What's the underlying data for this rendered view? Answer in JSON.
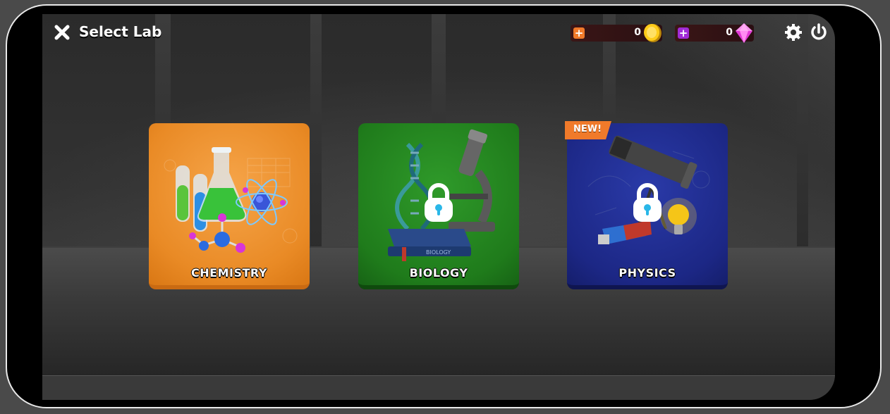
{
  "header": {
    "title": "Select Lab"
  },
  "currencies": {
    "coins": {
      "value": "0",
      "plus_color": "#f07a2a",
      "icon": "coin-icon"
    },
    "gems": {
      "value": "0",
      "plus_color": "#a12bd6",
      "icon": "gem-icon"
    }
  },
  "labs": [
    {
      "label": "CHEMISTRY",
      "locked": false,
      "color": "#ee8f2b"
    },
    {
      "label": "BIOLOGY",
      "locked": true,
      "color": "#238620"
    },
    {
      "label": "PHYSICS",
      "locked": true,
      "color": "#1f2a8f",
      "badge": "NEW!"
    }
  ],
  "icons": {
    "close": "close-icon",
    "settings": "gear-icon",
    "power": "power-icon",
    "lock": "lock-icon"
  }
}
